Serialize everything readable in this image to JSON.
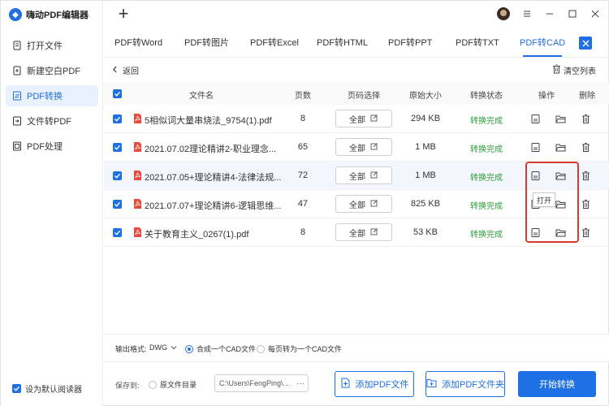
{
  "app": {
    "name": "嗨动PDF编辑器",
    "accent": "#1f6fe5",
    "success": "#2f9e3b",
    "highlight": "#d93a32"
  },
  "sidebar": {
    "items": [
      {
        "label": "打开文件",
        "icon": "file-open-icon"
      },
      {
        "label": "新建空白PDF",
        "icon": "new-pdf-icon"
      },
      {
        "label": "PDF转换",
        "icon": "pdf-convert-icon",
        "active": true
      },
      {
        "label": "文件转PDF",
        "icon": "file-to-pdf-icon"
      },
      {
        "label": "PDF处理",
        "icon": "pdf-process-icon"
      }
    ],
    "default_reader": "设为默认阅读器"
  },
  "topbar": {
    "add_tab": "+"
  },
  "tabs": [
    "PDF转Word",
    "PDF转图片",
    "PDF转Excel",
    "PDF转HTML",
    "PDF转PPT",
    "PDF转TXT",
    "PDF转CAD"
  ],
  "active_tab": "PDF转CAD",
  "toolbar": {
    "back": "返回",
    "clear": "清空列表"
  },
  "table": {
    "headers": {
      "name": "文件名",
      "pages": "页数",
      "range": "页码选择",
      "size": "原始大小",
      "status": "转换状态",
      "ops": "操作",
      "delete": "删除"
    },
    "rows": [
      {
        "name": "5相似词大量串烧法_9754(1).pdf",
        "pages": "8",
        "range": "全部",
        "size": "294 KB",
        "status": "转换完成"
      },
      {
        "name": "2021.07.02理论精讲2-职业理念...",
        "pages": "65",
        "range": "全部",
        "size": "1 MB",
        "status": "转换完成"
      },
      {
        "name": "2021.07.05+理论精讲4-法律法规...",
        "pages": "72",
        "range": "全部",
        "size": "1 MB",
        "status": "转换完成"
      },
      {
        "name": "2021.07.07+理论精讲6-逻辑思维...",
        "pages": "47",
        "range": "全部",
        "size": "825 KB",
        "status": "转换完成"
      },
      {
        "name": "关于教育主义_0267(1).pdf",
        "pages": "8",
        "range": "全部",
        "size": "53 KB",
        "status": "转换完成"
      }
    ],
    "tooltip": "打开"
  },
  "output": {
    "label": "输出格式:",
    "format": "DWG",
    "option_merge": "合成一个CAD文件",
    "option_each": "每页转为一个CAD文件"
  },
  "save": {
    "label": "保存到:",
    "option_source": "原文件目录",
    "path": "C:\\Users\\FengPing\\...",
    "more": "···"
  },
  "buttons": {
    "add_file": "添加PDF文件",
    "add_folder": "添加PDF文件夹",
    "start": "开始转换"
  }
}
